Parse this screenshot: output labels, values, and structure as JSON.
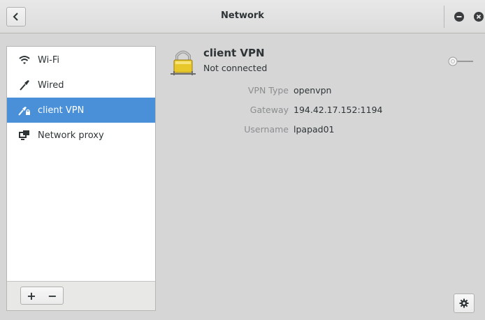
{
  "window": {
    "title": "Network"
  },
  "sidebar": {
    "items": [
      {
        "label": "Wi-Fi",
        "icon": "wifi-icon",
        "selected": false
      },
      {
        "label": "Wired",
        "icon": "wired-cable-icon",
        "selected": false
      },
      {
        "label": "client VPN",
        "icon": "vpn-lock-icon",
        "selected": true
      },
      {
        "label": "Network proxy",
        "icon": "network-proxy-icon",
        "selected": false
      }
    ],
    "add_label": "+",
    "remove_label": "−"
  },
  "vpn": {
    "name": "client VPN",
    "status": "Not connected",
    "switch_on": false,
    "details": [
      {
        "label": "VPN Type",
        "value": "openvpn"
      },
      {
        "label": "Gateway",
        "value": "194.42.17.152:1194"
      },
      {
        "label": "Username",
        "value": "lpapad01"
      }
    ]
  },
  "colors": {
    "selection": "#4a90d9",
    "background": "#d6d6d6",
    "muted_label": "#8b8e8f"
  }
}
